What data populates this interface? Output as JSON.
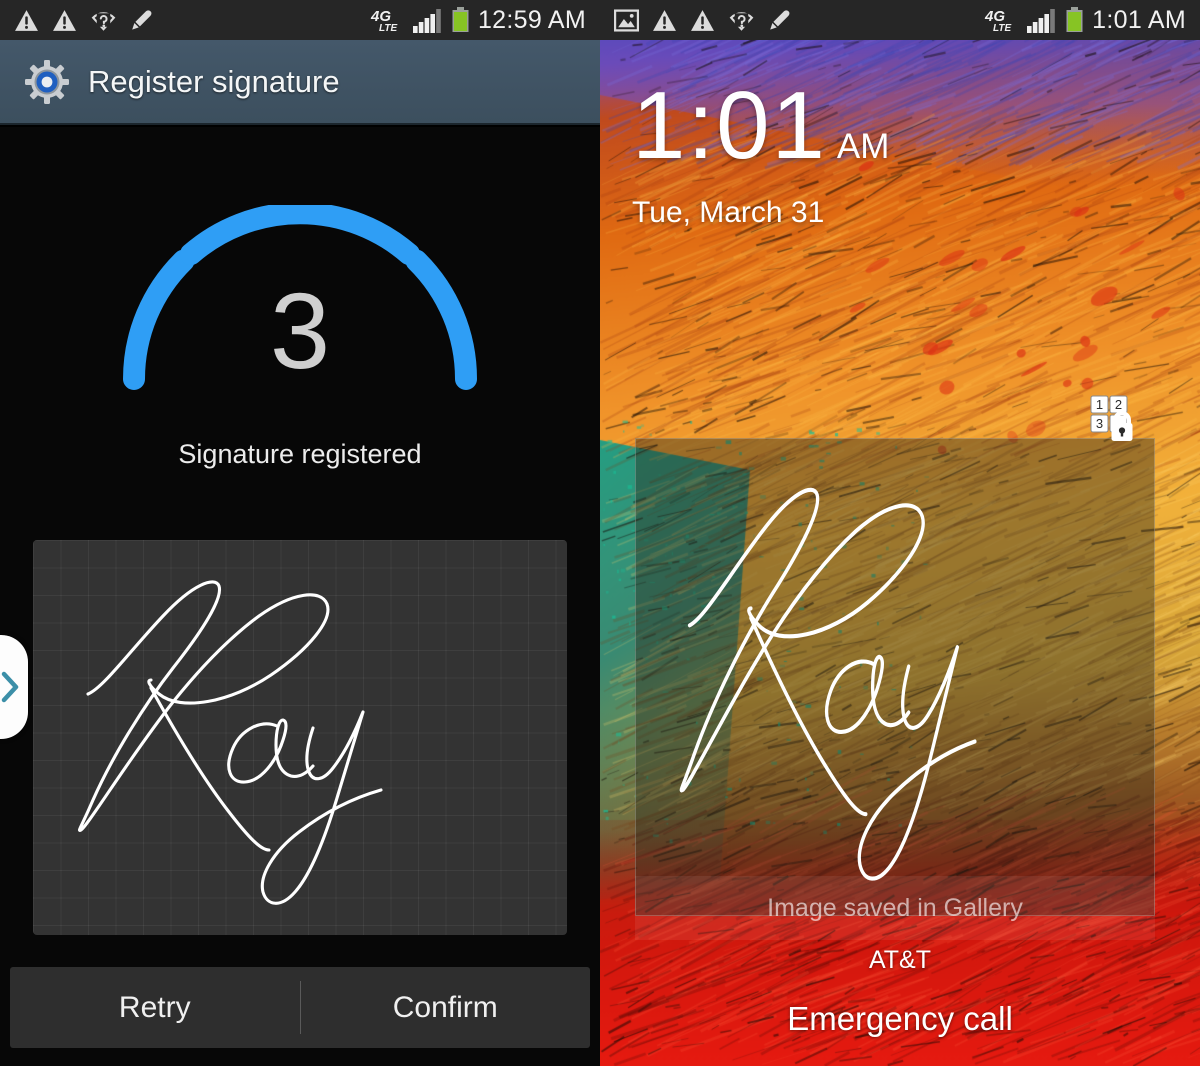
{
  "left_panel": {
    "status_bar": {
      "icons": [
        "warning-triangle-icon",
        "warning-triangle-icon",
        "wifi-question-icon",
        "stylus-pen-icon"
      ],
      "network_label": "4G",
      "network_sub": "LTE",
      "signal_icon": "signal-bars-icon",
      "battery_icon": "battery-full-icon",
      "clock": "12:59 AM"
    },
    "app_bar": {
      "icon": "settings-gear-icon",
      "title": "Register signature"
    },
    "gauge": {
      "count": "3",
      "total_segments": 3,
      "filled_segments": 3,
      "arc_color": "#2f9ef5",
      "count_color": "#cfcfcf"
    },
    "status_text": "Signature registered",
    "signature_pad": {
      "name": "signature-canvas",
      "signature_text": "Ray",
      "ink_color": "#ffffff",
      "background": "#333333"
    },
    "side_tab": {
      "icon": "chevron-right-icon",
      "color": "#3c8fa8"
    },
    "buttons": {
      "retry": "Retry",
      "confirm": "Confirm"
    }
  },
  "right_panel": {
    "status_bar": {
      "icons": [
        "gallery-image-icon",
        "warning-triangle-icon",
        "warning-triangle-icon",
        "wifi-question-icon",
        "stylus-pen-icon"
      ],
      "network_label": "4G",
      "network_sub": "LTE",
      "signal_icon": "signal-bars-icon",
      "battery_icon": "battery-full-icon",
      "clock": "1:01 AM"
    },
    "lockscreen": {
      "time": "1:01",
      "ampm": "AM",
      "date": "Tue, March 31",
      "pin_lock_icon": "pin-lock-icon",
      "pin_digits": [
        "1",
        "2",
        "3"
      ],
      "signature_overlay_text": "Ray",
      "toast": "Image saved in Gallery",
      "carrier": "AT&T",
      "emergency_call": "Emergency call"
    }
  }
}
